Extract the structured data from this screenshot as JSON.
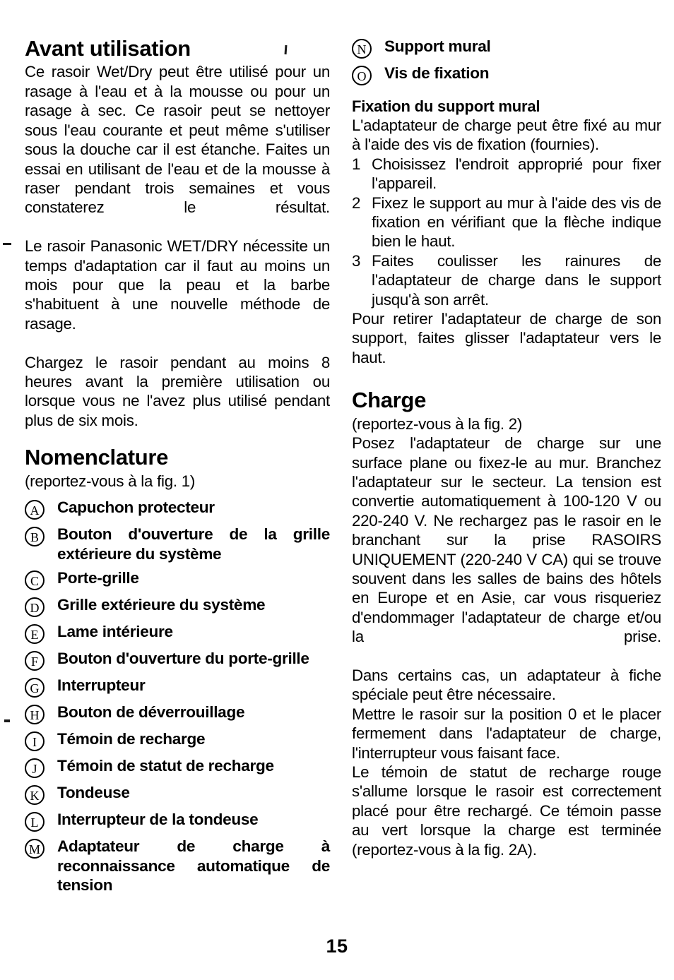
{
  "page": {
    "number": "15"
  },
  "left_column": {
    "section_title": "Avant utilisation",
    "intro_paragraphs": [
      "Ce rasoir Wet/Dry peut être utilisé pour un rasage à l'eau et à la mousse ou pour un rasage à sec. Ce rasoir peut se nettoyer sous l'eau courante et peut même s'utiliser sous la douche car il est étanche. Faites un essai en utilisant de l'eau et de la mousse à raser pendant trois semaines et vous constaterez le résultat.",
      "Le rasoir Panasonic WET/DRY nécessite un temps d'adaptation car il faut au moins un mois pour que la peau et la barbe s'habituent à une nouvelle méthode de rasage.",
      "Chargez le rasoir pendant au moins 8 heures avant la première utilisation ou lorsque vous ne l'avez plus utilisé pendant plus de six mois."
    ],
    "nomenclature": {
      "title": "Nomenclature",
      "figure_reference": "(reportez-vous à la fig. 1)",
      "items": [
        {
          "marker": "A",
          "label": "Capuchon protecteur"
        },
        {
          "marker": "B",
          "label": "Bouton d'ouverture de la grille extérieure du système"
        },
        {
          "marker": "C",
          "label": "Porte-grille"
        },
        {
          "marker": "D",
          "label": "Grille extérieure du système"
        },
        {
          "marker": "E",
          "label": "Lame intérieure"
        },
        {
          "marker": "F",
          "label": "Bouton d'ouverture du porte-grille"
        },
        {
          "marker": "G",
          "label": "Interrupteur"
        },
        {
          "marker": "H",
          "label": "Bouton de déverrouillage"
        },
        {
          "marker": "I",
          "label": "Témoin de recharge"
        },
        {
          "marker": "J",
          "label": "Témoin de statut de recharge"
        },
        {
          "marker": "K",
          "label": "Tondeuse"
        },
        {
          "marker": "L",
          "label": "Interrupteur de la tondeuse"
        },
        {
          "marker": "M",
          "label": "Adaptateur de charge à reconnaissance automatique de tension"
        }
      ]
    }
  },
  "right_column": {
    "nomenclature_continued": [
      {
        "marker": "N",
        "label": "Support mural"
      },
      {
        "marker": "O",
        "label": "Vis de fixation"
      }
    ],
    "wall_mount": {
      "title": "Fixation du support mural",
      "intro": "L'adaptateur de charge peut être fixé au mur à l'aide des vis de fixation (fournies).",
      "steps": [
        {
          "number": "1",
          "text": "Choisissez l'endroit approprié pour fixer l'appareil."
        },
        {
          "number": "2",
          "text": "Fixez le support au mur à l'aide des vis de fixation en vérifiant que la flèche indique bien le haut."
        },
        {
          "number": "3",
          "text": "Faites coulisser les rainures de l'adaptateur de charge dans le support jusqu'à son arrêt."
        }
      ],
      "closing": "Pour retirer l'adaptateur de charge de son support, faites glisser l'adaptateur vers le haut."
    },
    "charge": {
      "title": "Charge",
      "figure_reference": "(reportez-vous à la fig. 2)",
      "paragraphs": [
        "Posez l'adaptateur de charge sur une surface plane ou fixez-le au mur. Branchez l'adaptateur sur le secteur. La tension est convertie automatiquement à 100-120 V ou 220-240 V. Ne rechargez pas le rasoir en le branchant sur la prise RASOIRS UNIQUEMENT (220-240 V CA) qui se trouve souvent dans les salles de bains des hôtels en Europe et en Asie, car vous risqueriez d'endommager l'adaptateur de charge et/ou la prise.",
        "Dans certains cas, un adaptateur à fiche spéciale peut être nécessaire.",
        "Mettre le rasoir sur la position 0 et le placer fermement dans l'adaptateur de charge, l'interrupteur vous faisant face.",
        "Le témoin de statut de recharge rouge s'allume lorsque le rasoir est correctement placé pour être rechargé. Ce témoin passe au vert lorsque la charge est terminée (reportez-vous à la fig. 2A)."
      ]
    }
  }
}
